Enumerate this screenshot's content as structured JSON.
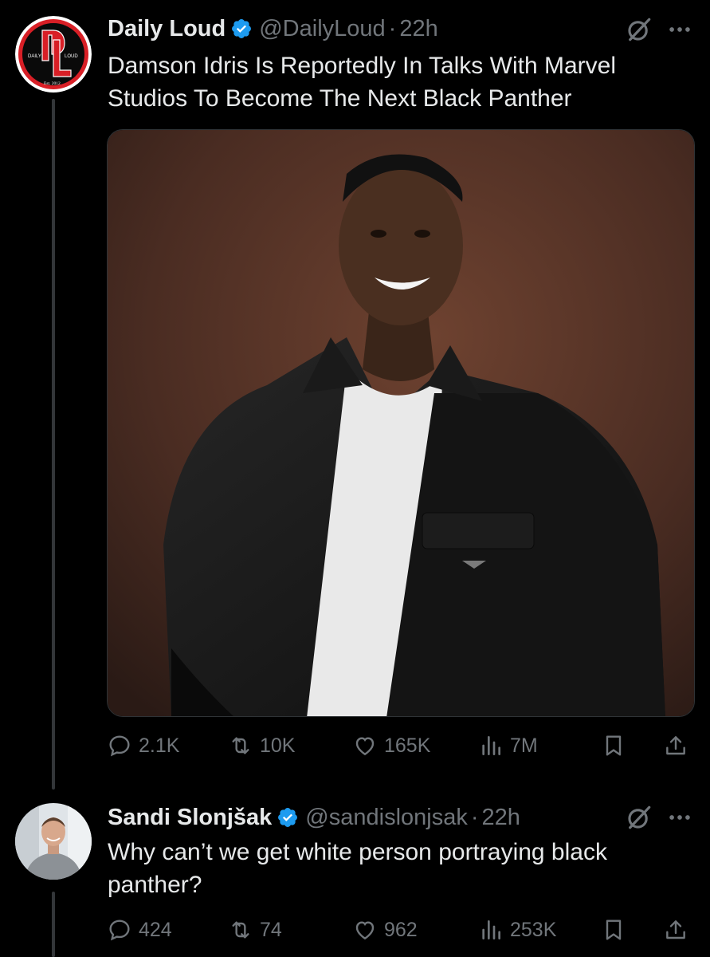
{
  "tweet1": {
    "display_name": "Daily Loud",
    "handle": "@DailyLoud",
    "separator": "·",
    "time": "22h",
    "text": "Damson Idris Is Reportedly In Talks With Marvel Studios To Become The Next Black Panther",
    "avatar": {
      "logo_letters": "DL",
      "left_word": "DAILY",
      "right_word": "LOUD",
      "est": "Est. 2012"
    },
    "replies": "2.1K",
    "reposts": "10K",
    "likes": "165K",
    "views": "7M"
  },
  "tweet2": {
    "display_name": "Sandi Slonjšak",
    "handle": "@sandislonjsak",
    "separator": "·",
    "time": "22h",
    "text": "Why can’t we get white person portraying black panther?",
    "replies": "424",
    "reposts": "74",
    "likes": "962",
    "views": "253K"
  },
  "colors": {
    "background": "#000000",
    "text": "#e7e9ea",
    "muted": "#71767b",
    "verified": "#1d9bf0",
    "logo_red": "#d81f26"
  },
  "icons": [
    "verified-badge-icon",
    "grok-icon",
    "more-icon",
    "reply-icon",
    "repost-icon",
    "like-icon",
    "views-icon",
    "bookmark-icon",
    "share-icon"
  ]
}
